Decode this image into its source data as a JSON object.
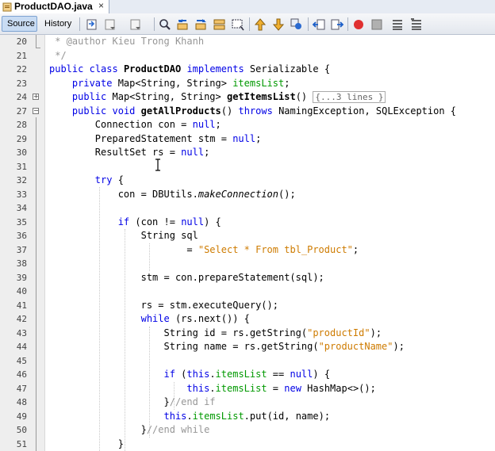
{
  "tab": {
    "title": "ProductDAO.java",
    "close_glyph": "×",
    "icon": "java-file-icon"
  },
  "toolbar": {
    "source_label": "Source",
    "history_label": "History",
    "icons": [
      "go-to-last-edit-icon",
      "back-icon",
      "forward-icon",
      "find-icon",
      "find-previous-icon",
      "find-next-icon",
      "toggle-highlight-icon",
      "toggle-rectangular-selection-icon",
      "previous-bookmark-icon",
      "next-bookmark-icon",
      "toggle-bookmark-icon",
      "shift-left-icon",
      "shift-right-icon",
      "start-macro-icon",
      "stop-macro-icon",
      "comment-icon",
      "uncomment-icon"
    ]
  },
  "editor": {
    "lines": [
      {
        "num": "20",
        "code": " * @author Kieu Trong Khanh"
      },
      {
        "num": "21",
        "code": " */"
      },
      {
        "num": "22",
        "code": "public class ProductDAO implements Serializable {"
      },
      {
        "num": "23",
        "code": "    private Map<String, String> itemsList;"
      },
      {
        "num": "24",
        "code": "    public Map<String, String> getItemsList() {...3 lines }"
      },
      {
        "num": "27",
        "code": "    public void getAllProducts() throws NamingException, SQLException {"
      },
      {
        "num": "28",
        "code": "        Connection con = null;"
      },
      {
        "num": "29",
        "code": "        PreparedStatement stm = null;"
      },
      {
        "num": "30",
        "code": "        ResultSet rs = null;"
      },
      {
        "num": "31",
        "code": ""
      },
      {
        "num": "32",
        "code": "        try {"
      },
      {
        "num": "33",
        "code": "            con = DBUtils.makeConnection();"
      },
      {
        "num": "34",
        "code": ""
      },
      {
        "num": "35",
        "code": "            if (con != null) {"
      },
      {
        "num": "36",
        "code": "                String sql"
      },
      {
        "num": "37",
        "code": "                        = \"Select * From tbl_Product\";"
      },
      {
        "num": "38",
        "code": ""
      },
      {
        "num": "39",
        "code": "                stm = con.prepareStatement(sql);"
      },
      {
        "num": "40",
        "code": ""
      },
      {
        "num": "41",
        "code": "                rs = stm.executeQuery();"
      },
      {
        "num": "42",
        "code": "                while (rs.next()) {"
      },
      {
        "num": "43",
        "code": "                    String id = rs.getString(\"productId\");"
      },
      {
        "num": "44",
        "code": "                    String name = rs.getString(\"productName\");"
      },
      {
        "num": "45",
        "code": ""
      },
      {
        "num": "46",
        "code": "                    if (this.itemsList == null) {"
      },
      {
        "num": "47",
        "code": "                        this.itemsList = new HashMap<>();"
      },
      {
        "num": "48",
        "code": "                    }//end if"
      },
      {
        "num": "49",
        "code": "                    this.itemsList.put(id, name);"
      },
      {
        "num": "50",
        "code": "                }//end while"
      },
      {
        "num": "51",
        "code": "            }"
      }
    ]
  }
}
